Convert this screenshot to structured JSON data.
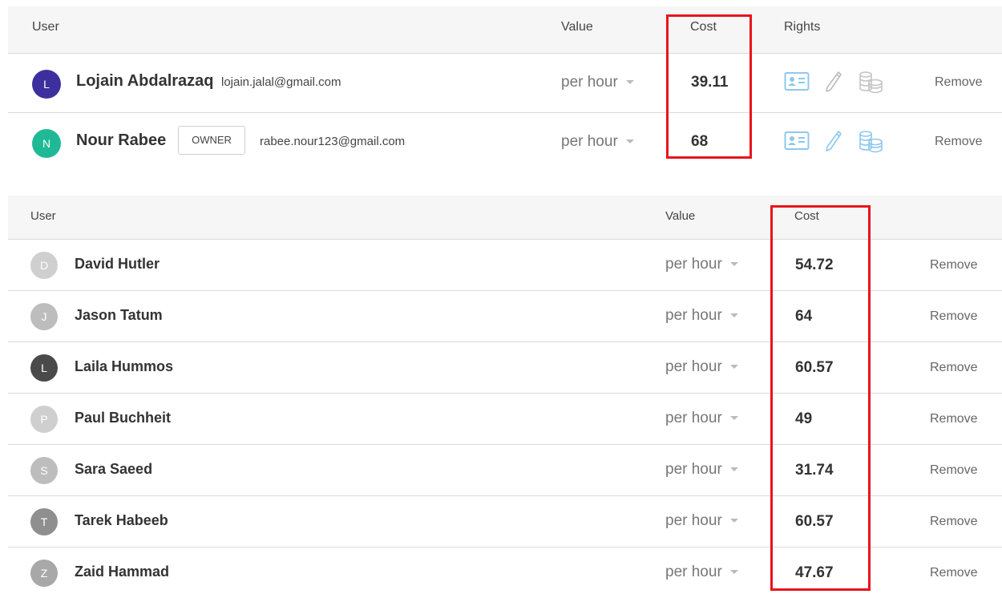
{
  "table1": {
    "headers": {
      "user": "User",
      "value": "Value",
      "cost": "Cost",
      "rights": "Rights"
    },
    "rows": [
      {
        "initial": "L",
        "avatar_color": "#3d2f9e",
        "name": "Lojain Abdalrazaq",
        "email": "lojain.jalal@gmail.com",
        "value": "per hour",
        "cost": "39.11",
        "rights_icons": [
          "contact-card-icon",
          "pencil-icon",
          "coins-icon"
        ],
        "remove": "Remove"
      },
      {
        "initial": "N",
        "avatar_color": "#1fb996",
        "name": "Nour Rabee",
        "badge": "OWNER",
        "email": "rabee.nour123@gmail.com",
        "value": "per hour",
        "cost": "68",
        "rights_icons": [
          "contact-card-icon",
          "pencil-icon",
          "coins-icon"
        ],
        "remove": "Remove"
      }
    ]
  },
  "table2": {
    "headers": {
      "user": "User",
      "value": "Value",
      "cost": "Cost"
    },
    "rows": [
      {
        "initial": "D",
        "avatar_color": "#cfcfcf",
        "name": "David Hutler",
        "value": "per hour",
        "cost": "54.72",
        "remove": "Remove"
      },
      {
        "initial": "J",
        "avatar_color": "#bdbdbd",
        "name": "Jason Tatum",
        "value": "per hour",
        "cost": "64",
        "remove": "Remove"
      },
      {
        "initial": "L",
        "avatar_color": "#4a4a4a",
        "name": "Laila Hummos",
        "value": "per hour",
        "cost": "60.57",
        "remove": "Remove"
      },
      {
        "initial": "P",
        "avatar_color": "#cfcfcf",
        "name": "Paul Buchheit",
        "value": "per hour",
        "cost": "49",
        "remove": "Remove"
      },
      {
        "initial": "S",
        "avatar_color": "#bdbdbd",
        "name": "Sara Saeed",
        "value": "per hour",
        "cost": "31.74",
        "remove": "Remove"
      },
      {
        "initial": "T",
        "avatar_color": "#8f8f8f",
        "name": "Tarek Habeeb",
        "value": "per hour",
        "cost": "60.57",
        "remove": "Remove"
      },
      {
        "initial": "Z",
        "avatar_color": "#a8a8a8",
        "name": "Zaid Hammad",
        "value": "per hour",
        "cost": "47.67",
        "remove": "Remove"
      }
    ]
  },
  "highlight_color": "#e8141c"
}
